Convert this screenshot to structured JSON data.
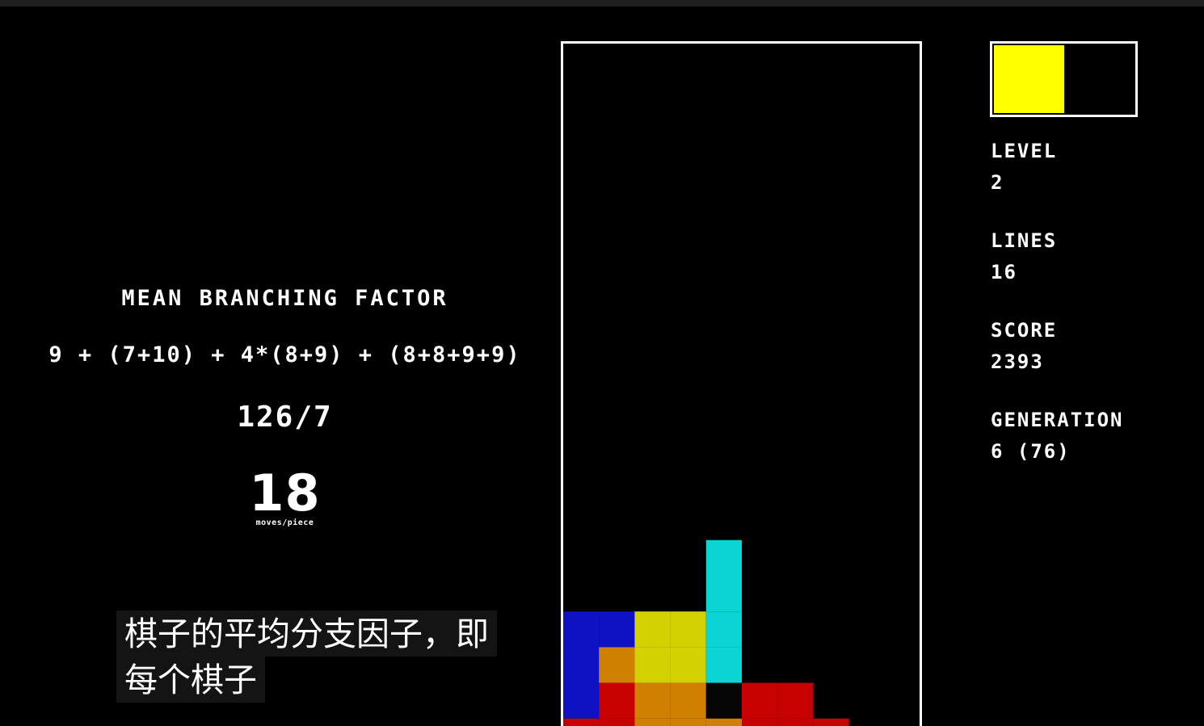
{
  "mean_branching": {
    "title": "MEAN BRANCHING FACTOR",
    "formula": "9 + (7+10) + 4*(8+9) + (8+8+9+9)",
    "fraction": "126/7",
    "result": "18",
    "unit": "moves/piece"
  },
  "subtitle": {
    "line1": "棋子的平均分支因子，即",
    "line2": "每个棋子"
  },
  "stats": {
    "level_label": "LEVEL",
    "level_value": "2",
    "lines_label": "LINES",
    "lines_value": "16",
    "score_label": "SCORE",
    "score_value": "2393",
    "generation_label": "GENERATION",
    "generation_value": "6 (76)"
  },
  "next_piece": {
    "color": "#ffff00"
  },
  "colors": {
    "background": "#000000",
    "border": "#ffffff",
    "blue": "#0f12c4",
    "orange": "#cf8000",
    "yellow": "#d4d100",
    "cyan": "#0bd4d4",
    "red": "#c70000",
    "dark": "#050505"
  },
  "board_cells": [
    {
      "row": 14,
      "col": 4,
      "color": "cyan"
    },
    {
      "row": 15,
      "col": 4,
      "color": "cyan"
    },
    {
      "row": 16,
      "col": 0,
      "color": "blue"
    },
    {
      "row": 16,
      "col": 1,
      "color": "blue"
    },
    {
      "row": 16,
      "col": 3,
      "color": "yellow"
    },
    {
      "row": 16,
      "col": 4,
      "color": "cyan"
    },
    {
      "row": 16,
      "col": 2,
      "color": "yellow"
    },
    {
      "row": 17,
      "col": 0,
      "color": "blue"
    },
    {
      "row": 17,
      "col": 1,
      "color": "orange"
    },
    {
      "row": 17,
      "col": 2,
      "color": "orange"
    },
    {
      "row": 17,
      "col": 3,
      "color": "yellow"
    },
    {
      "row": 17,
      "col": 4,
      "color": "cyan"
    },
    {
      "row": 17,
      "col": 2,
      "color": "yellow"
    },
    {
      "row": 18,
      "col": 0,
      "color": "blue"
    },
    {
      "row": 18,
      "col": 1,
      "color": "red"
    },
    {
      "row": 18,
      "col": 2,
      "color": "orange"
    },
    {
      "row": 18,
      "col": 3,
      "color": "orange"
    },
    {
      "row": 18,
      "col": 4,
      "color": "dark"
    },
    {
      "row": 18,
      "col": 5,
      "color": "red"
    },
    {
      "row": 18,
      "col": 6,
      "color": "red"
    },
    {
      "row": 19,
      "col": 0,
      "color": "red"
    },
    {
      "row": 19,
      "col": 1,
      "color": "red"
    },
    {
      "row": 19,
      "col": 2,
      "color": "orange"
    },
    {
      "row": 19,
      "col": 3,
      "color": "orange"
    },
    {
      "row": 19,
      "col": 4,
      "color": "orange"
    },
    {
      "row": 19,
      "col": 5,
      "color": "red"
    },
    {
      "row": 19,
      "col": 6,
      "color": "red"
    },
    {
      "row": 19,
      "col": 7,
      "color": "red"
    }
  ]
}
